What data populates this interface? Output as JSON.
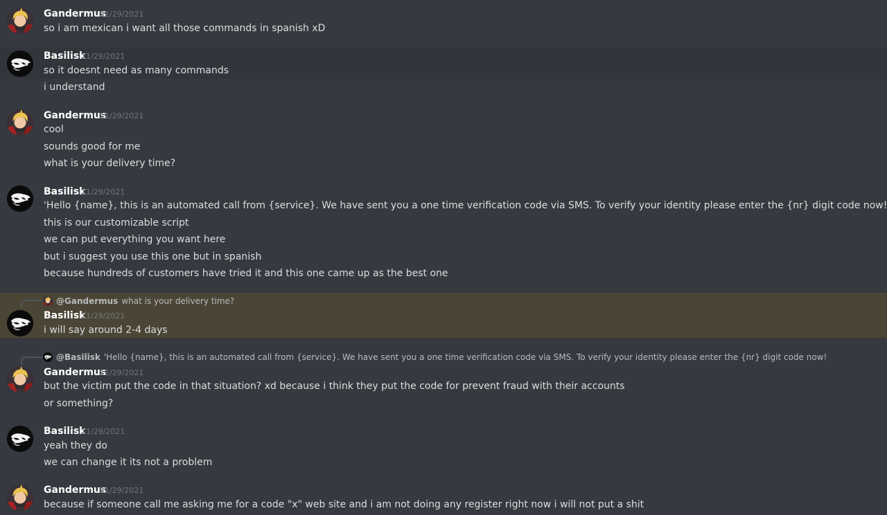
{
  "messages": [
    {
      "author": "Gandermus",
      "time": "11/29/2021",
      "lines": [
        "so i am mexican i want all those commands in spanish xD"
      ]
    },
    {
      "author": "Basilisk",
      "time": "11/29/2021",
      "lines": [
        "so it doesnt need as many commands",
        "i understand"
      ]
    },
    {
      "author": "Gandermus",
      "time": "11/29/2021",
      "lines": [
        "cool",
        "sounds good for me",
        "what is your delivery time?"
      ]
    },
    {
      "author": "Basilisk",
      "time": "11/29/2021",
      "lines": [
        "'Hello {name}, this is an automated call from {service}. We have sent you a one time verification code via SMS. To verify your identity please enter the {nr} digit code now!",
        "this is our customizable script",
        "we can put everything you want here",
        "but i suggest you use this one but in spanish",
        "because hundreds of customers have tried it and this one came up as the best one"
      ]
    },
    {
      "author": "Basilisk",
      "time": "11/29/2021",
      "reply": {
        "author": "@Gandermus",
        "text": "what is your delivery time?"
      },
      "lines": [
        "i will say around 2-4 days"
      ]
    },
    {
      "author": "Gandermus",
      "time": "11/29/2021",
      "reply": {
        "author": "@Basilisk",
        "text": "'Hello {name}, this is an automated call from {service}. We have sent you a one time verification code via SMS. To verify your identity please enter the {nr} digit code now!"
      },
      "lines": [
        "but the victim put the code in that situation? xd because i think they put the code for prevent fraud with their accounts",
        "or something?"
      ]
    },
    {
      "author": "Basilisk",
      "time": "11/29/2021",
      "lines": [
        "yeah they do",
        "we can change it its not a problem"
      ]
    },
    {
      "author": "Gandermus",
      "time": "11/29/2021",
      "lines": [
        "because if someone call me asking me for a code \"x\" web site and i am not doing any register right now i will not put a shit"
      ]
    }
  ]
}
